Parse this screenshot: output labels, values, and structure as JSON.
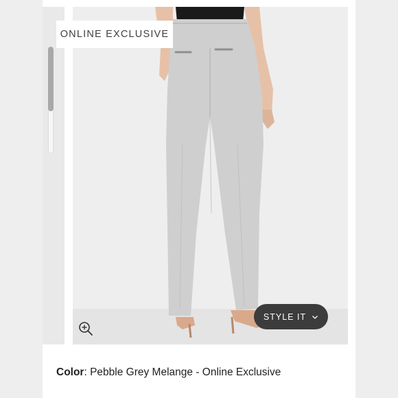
{
  "badge": {
    "text": "ONLINE EXCLUSIVE"
  },
  "style_button": {
    "label": "STYLE IT",
    "icon": "chevron-down-icon"
  },
  "zoom": {
    "icon": "zoom-in-icon"
  },
  "product": {
    "color_label": "Color",
    "color_separator": ":",
    "color_value": "Pebble Grey Melange - Online Exclusive"
  },
  "colors": {
    "pants": "#cfcfcf",
    "background": "#ebebeb",
    "button": "#3c3c3c",
    "text": "#222222"
  }
}
